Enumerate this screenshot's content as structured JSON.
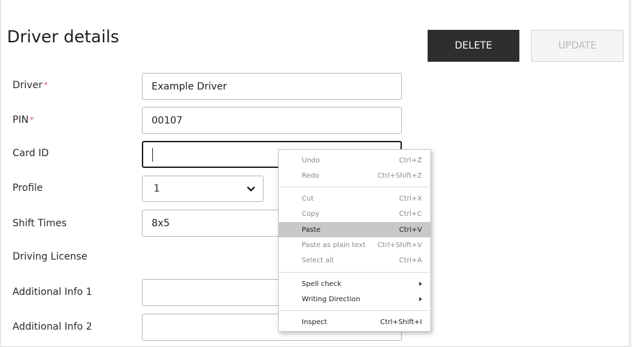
{
  "page": {
    "title": "Driver details",
    "delete_label": "DELETE",
    "update_label": "UPDATE"
  },
  "form": {
    "driver": {
      "label": "Driver",
      "required": "*",
      "value": "Example Driver"
    },
    "pin": {
      "label": "PIN",
      "required": "*",
      "value": "00107"
    },
    "card_id": {
      "label": "Card ID",
      "value": ""
    },
    "profile": {
      "label": "Profile",
      "value": "1"
    },
    "shift_times": {
      "label": "Shift Times",
      "value": "8x5"
    },
    "driving_license": {
      "label": "Driving License"
    },
    "additional_info_1": {
      "label": "Additional Info 1",
      "value": ""
    },
    "additional_info_2": {
      "label": "Additional Info 2",
      "value": ""
    }
  },
  "context_menu": {
    "undo": {
      "label": "Undo",
      "shortcut": "Ctrl+Z"
    },
    "redo": {
      "label": "Redo",
      "shortcut": "Ctrl+Shift+Z"
    },
    "cut": {
      "label": "Cut",
      "shortcut": "Ctrl+X"
    },
    "copy": {
      "label": "Copy",
      "shortcut": "Ctrl+C"
    },
    "paste": {
      "label": "Paste",
      "shortcut": "Ctrl+V"
    },
    "paste_plain": {
      "label": "Paste as plain text",
      "shortcut": "Ctrl+Shift+V"
    },
    "select_all": {
      "label": "Select all",
      "shortcut": "Ctrl+A"
    },
    "spell_check": {
      "label": "Spell check"
    },
    "writing_direction": {
      "label": "Writing Direction"
    },
    "inspect": {
      "label": "Inspect",
      "shortcut": "Ctrl+Shift+I"
    }
  },
  "colors": {
    "delete_bg": "#2e2e2e",
    "required_star": "#e0405a",
    "menu_highlight": "#c8c8c8"
  }
}
